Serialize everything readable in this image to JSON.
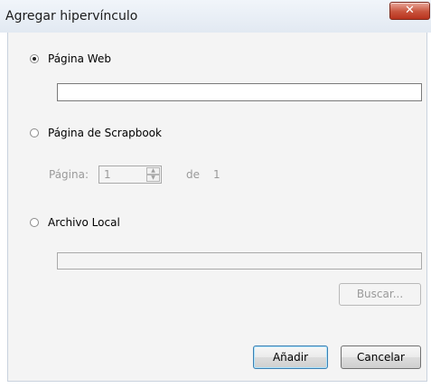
{
  "window": {
    "title": "Agregar hipervínculo",
    "close_icon": "close-icon"
  },
  "options": [
    {
      "label": "Página Web",
      "selected": true
    },
    {
      "label": "Página de Scrapbook",
      "selected": false
    },
    {
      "label": "Archivo Local",
      "selected": false
    }
  ],
  "web_page": {
    "url_value": ""
  },
  "scrapbook": {
    "page_label": "Página:",
    "page_value": "1",
    "of_label": "de",
    "total_pages": "1"
  },
  "local_file": {
    "path_value": ""
  },
  "buttons": {
    "browse": "Buscar...",
    "add": "Añadir",
    "cancel": "Cancelar"
  },
  "colors": {
    "close_button": "#c8533c",
    "dialog_background": "#f4f4f4"
  }
}
